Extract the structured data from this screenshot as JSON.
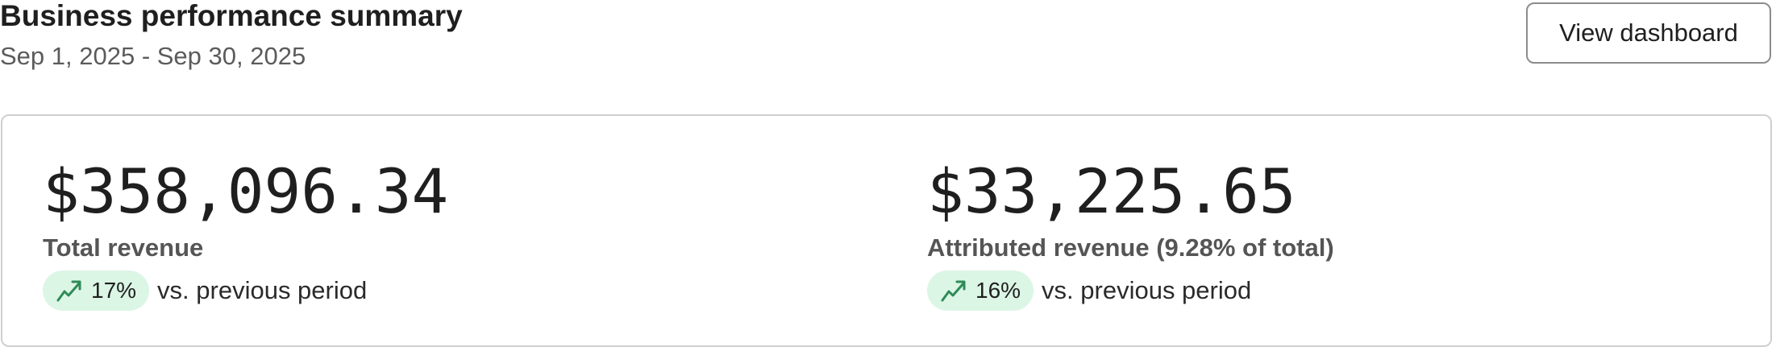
{
  "header": {
    "title": "Business performance summary",
    "date_range": "Sep 1, 2025 - Sep 30, 2025",
    "view_dashboard_label": "View dashboard"
  },
  "metrics": [
    {
      "value": "$358,096.34",
      "label": "Total revenue",
      "change": "17%",
      "change_icon": "trending-up-icon",
      "comparison": "vs. previous period"
    },
    {
      "value": "$33,225.65",
      "label": "Attributed revenue (9.28% of total)",
      "change": "16%",
      "change_icon": "trending-up-icon",
      "comparison": "vs. previous period"
    }
  ],
  "colors": {
    "badge_background": "#dcf6e6",
    "trend_up": "#2e8b57",
    "text_primary": "#1f1f1f",
    "text_secondary": "#5b5b5b"
  }
}
